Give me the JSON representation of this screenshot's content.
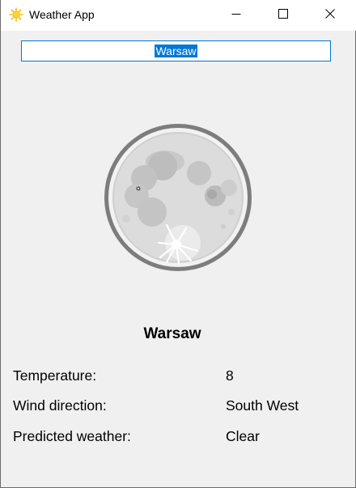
{
  "window": {
    "title": "Weather App",
    "icon": "sun-icon",
    "controls": [
      "minimize-icon",
      "maximize-icon",
      "close-icon"
    ]
  },
  "search": {
    "value": "Warsaw"
  },
  "weather_icon": "full-moon-icon",
  "city": "Warsaw",
  "details": [
    {
      "label": "Temperature:",
      "value": "8"
    },
    {
      "label": "Wind direction:",
      "value": "South West"
    },
    {
      "label": "Predicted weather:",
      "value": "Clear"
    }
  ],
  "colors": {
    "accent": "#0078d7",
    "background": "#f0f0f0",
    "titlebar": "#ffffff"
  }
}
